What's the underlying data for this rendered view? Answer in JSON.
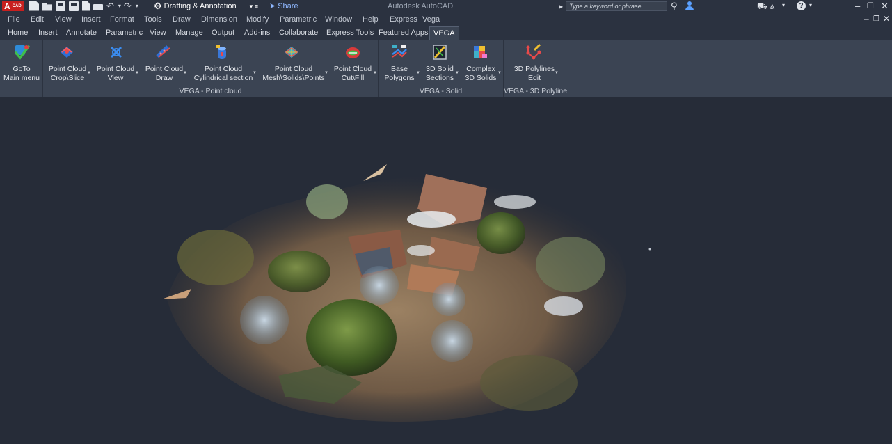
{
  "app": {
    "logo_letter": "A",
    "logo_tag": "CAD",
    "title": "Autodesk AutoCAD",
    "workspace": "Drafting & Annotation",
    "share_label": "Share",
    "search_placeholder": "Type a keyword or phrase"
  },
  "quick_access": [
    "new-icon",
    "open-icon",
    "save-icon",
    "save-as-icon",
    "plot-icon",
    "print-icon",
    "undo-icon",
    "redo-icon"
  ],
  "menu": [
    "File",
    "Edit",
    "View",
    "Insert",
    "Format",
    "Tools",
    "Draw",
    "Dimension",
    "Modify",
    "Parametric",
    "Window",
    "Help",
    "Express",
    "Vega"
  ],
  "ribbon_tabs": [
    "Home",
    "Insert",
    "Annotate",
    "Parametric",
    "View",
    "Manage",
    "Output",
    "Add-ins",
    "Collaborate",
    "Express Tools",
    "Featured Apps",
    "VEGA"
  ],
  "active_tab": "VEGA",
  "ribbon": {
    "goto": {
      "line1": "GoTo",
      "line2": "Main menu"
    },
    "point_cloud": {
      "title": "VEGA - Point cloud",
      "buttons": [
        {
          "line1": "Point Cloud",
          "line2": "Crop\\Slice"
        },
        {
          "line1": "Point Cloud",
          "line2": "View"
        },
        {
          "line1": "Point Cloud",
          "line2": "Draw"
        },
        {
          "line1": "Point Cloud",
          "line2": "Cylindrical section"
        },
        {
          "line1": "Point Cloud",
          "line2": "Mesh\\Solids\\Points"
        },
        {
          "line1": "Point Cloud",
          "line2": "Cut\\Fill"
        }
      ]
    },
    "solid": {
      "title": "VEGA - Solid",
      "buttons": [
        {
          "line1": "Base",
          "line2": "Polygons"
        },
        {
          "line1": "3D Solid",
          "line2": "Sections"
        },
        {
          "line1": "Complex",
          "line2": "3D Solids"
        }
      ]
    },
    "polyline": {
      "title": "VEGA - 3D Polyline",
      "buttons": [
        {
          "line1": "3D Polylines",
          "line2": "Edit"
        }
      ]
    }
  },
  "colors": {
    "titlebar": "#2b3240",
    "ribbon": "#3b4453",
    "viewport": "#262c38",
    "accent_blue": "#5aa0ff",
    "logo_red": "#c8201f"
  }
}
